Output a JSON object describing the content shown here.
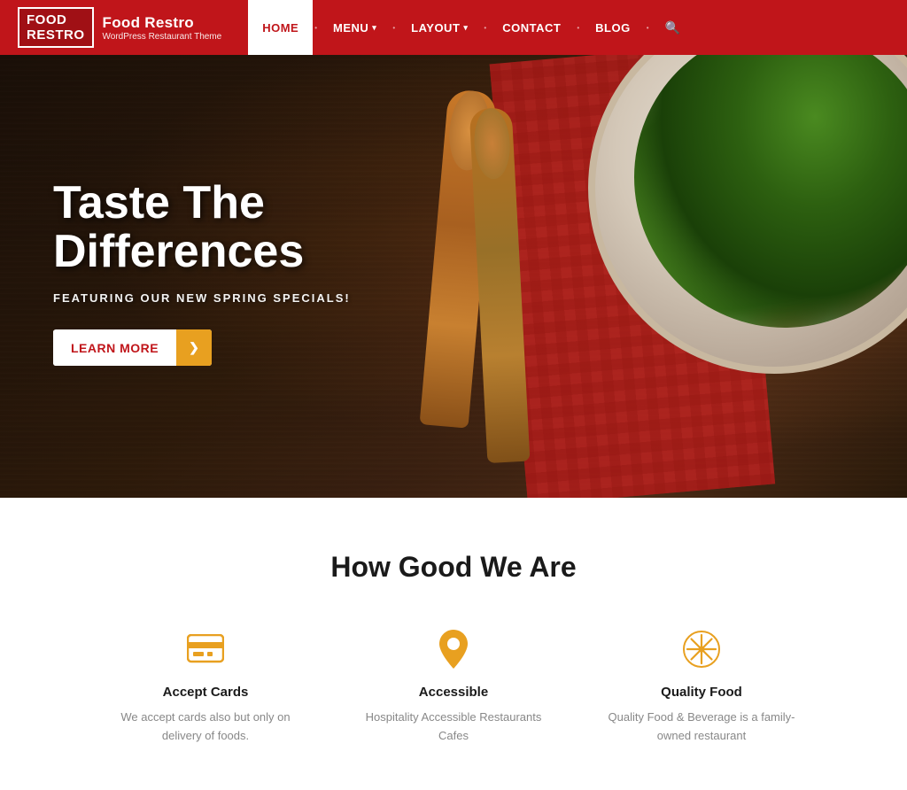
{
  "header": {
    "logo_line1": "Food",
    "logo_line2": "Restro",
    "site_name": "Food Restro",
    "site_tagline": "WordPress Restaurant Theme",
    "nav": [
      {
        "id": "home",
        "label": "HOME",
        "active": true,
        "has_arrow": false
      },
      {
        "id": "menu",
        "label": "MENU",
        "active": false,
        "has_arrow": true
      },
      {
        "id": "layout",
        "label": "LAYOUT",
        "active": false,
        "has_arrow": true
      },
      {
        "id": "contact",
        "label": "CONTACT",
        "active": false,
        "has_arrow": false
      },
      {
        "id": "blog",
        "label": "BLOG",
        "active": false,
        "has_arrow": false
      }
    ]
  },
  "hero": {
    "title_line1": "Taste The",
    "title_line2": "Differences",
    "subtitle": "FEATURING OUR NEW SPRING SPECIALS!",
    "btn_label": "Learn More",
    "btn_arrow": "❯"
  },
  "features": {
    "section_title": "How Good We Are",
    "items": [
      {
        "id": "accept-cards",
        "icon": "card",
        "name": "Accept Cards",
        "desc": "We accept cards also but only on delivery of foods."
      },
      {
        "id": "accessible",
        "icon": "pin",
        "name": "Accessible",
        "desc": "Hospitality Accessible Restaurants Cafes"
      },
      {
        "id": "quality-food",
        "icon": "snowflake",
        "name": "Quality Food",
        "desc": "Quality Food & Beverage is a family-owned restaurant"
      }
    ]
  }
}
